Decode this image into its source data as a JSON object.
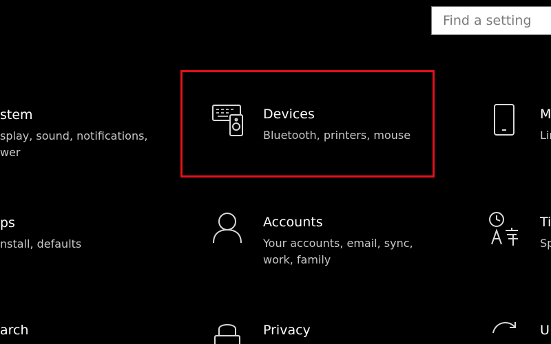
{
  "search": {
    "placeholder": "Find a setting"
  },
  "tiles": [
    {
      "title": "stem",
      "desc_lines": [
        "splay, sound, notifications,",
        "wer"
      ]
    },
    {
      "title": "Devices",
      "desc_lines": [
        "Bluetooth, printers, mouse"
      ]
    },
    {
      "title": "M",
      "desc_lines": [
        "Lir"
      ]
    },
    {
      "title": "ps",
      "desc_lines": [
        "nstall, defaults"
      ]
    },
    {
      "title": "Accounts",
      "desc_lines": [
        "Your accounts, email, sync,",
        "work, family"
      ]
    },
    {
      "title": "Ti",
      "desc_lines": [
        "Sp"
      ]
    },
    {
      "title": "arch",
      "desc_lines": []
    },
    {
      "title": "Privacy",
      "desc_lines": []
    },
    {
      "title": "U",
      "desc_lines": []
    }
  ],
  "icons": {
    "devices": "devices-icon",
    "phone": "phone-icon",
    "accounts": "person-icon",
    "time_language": "time-language-icon",
    "privacy": "lock-icon",
    "update": "refresh-icon"
  },
  "colors": {
    "background": "#000000",
    "highlight": "#e3121b",
    "text": "#ffffff",
    "subtext": "#c8c8c8"
  }
}
